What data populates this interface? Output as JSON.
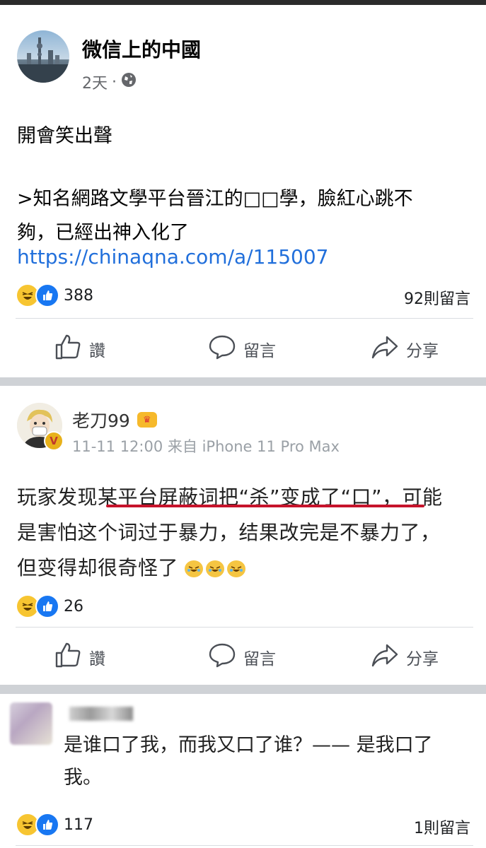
{
  "post1": {
    "author": "微信上的中國",
    "time": "2天",
    "separator": "·",
    "line1": "開會笑出聲",
    "line2": ">知名網路文學平台晉江的□□學，臉紅心跳不",
    "line3": "夠，已經出神入化了",
    "link": "https://chinaqna.com/a/115007",
    "reaction_count": "388",
    "comments": "92則留言",
    "actions": {
      "like": "讚",
      "comment": "留言",
      "share": "分享"
    }
  },
  "post2": {
    "author": "老刀99",
    "meta": "11-11 12:00 来自 iPhone 11 Pro Max",
    "line1": "玩家发现某平台屏蔽词把“杀”变成了“口”，可能",
    "line2": "是害怕这个词过于暴力，结果改完是不暴力了，",
    "line3": "但变得却很奇怪了",
    "reaction_count": "26",
    "actions": {
      "like": "讚",
      "comment": "留言",
      "share": "分享"
    }
  },
  "post3": {
    "line1": "是谁口了我，而我又口了谁？—— 是我口了",
    "line2": "我。",
    "reaction_count": "117",
    "comments": "1則留言"
  }
}
